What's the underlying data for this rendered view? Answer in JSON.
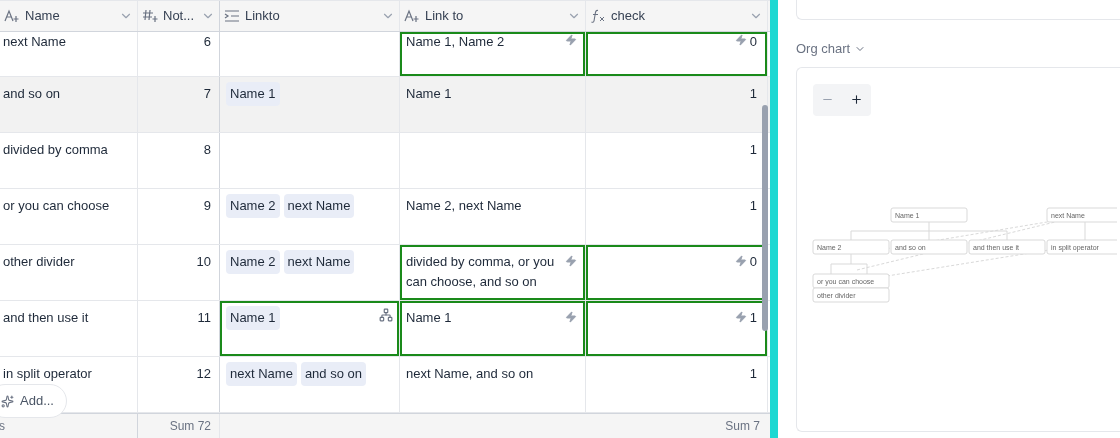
{
  "table": {
    "columns": [
      {
        "label": "Name",
        "kind": "text"
      },
      {
        "label": "Not...",
        "kind": "number"
      },
      {
        "label": "Linkto",
        "kind": "link"
      },
      {
        "label": "Link to",
        "kind": "lookup"
      },
      {
        "label": "check",
        "kind": "formula"
      }
    ],
    "rows": [
      {
        "name": "next Name",
        "number": "6",
        "tags": [],
        "link_to": {
          "text": "Name 1, Name 2",
          "highlighted": true
        },
        "check": {
          "text": "0",
          "highlighted": true
        },
        "linkto_highlighted": false,
        "hovered": false
      },
      {
        "name": "and so on",
        "number": "7",
        "tags": [
          "Name 1"
        ],
        "link_to": {
          "text": "Name 1",
          "highlighted": false
        },
        "check": {
          "text": "1",
          "highlighted": false
        },
        "linkto_highlighted": false,
        "hovered": true
      },
      {
        "name": "divided by comma",
        "number": "8",
        "tags": [],
        "link_to": {
          "highlighted": false
        },
        "check": {
          "text": "1",
          "highlighted": false
        },
        "linkto_highlighted": false,
        "hovered": false
      },
      {
        "name": "or you can choose",
        "number": "9",
        "tags": [
          "Name 2",
          "next Name"
        ],
        "link_to": {
          "text": "Name 2, next Name",
          "highlighted": false
        },
        "check": {
          "text": "1",
          "highlighted": false
        },
        "linkto_highlighted": false,
        "hovered": false
      },
      {
        "name": "other divider",
        "number": "10",
        "tags": [
          "Name 2",
          "next Name"
        ],
        "link_to": {
          "text": "divided by comma, or you can choose, and so on",
          "highlighted": true
        },
        "check": {
          "text": "0",
          "highlighted": true
        },
        "linkto_highlighted": false,
        "hovered": false
      },
      {
        "name": "and then use it",
        "number": "11",
        "tags": [
          "Name 1"
        ],
        "link_to": {
          "text": "Name 1",
          "highlighted": true
        },
        "check": {
          "text": "1",
          "highlighted": true
        },
        "linkto_highlighted": true,
        "hovered": false
      },
      {
        "name": "in split operator",
        "number": "12",
        "tags": [
          "next Name",
          "and so on"
        ],
        "link_to": {
          "text": "next Name, and so on",
          "highlighted": false
        },
        "check": {
          "text": "1",
          "highlighted": false
        },
        "linkto_highlighted": false,
        "hovered": false
      }
    ],
    "footer": {
      "count": "s",
      "number_sum": "Sum 72",
      "check_sum": "Sum 7"
    },
    "add_button": "Add..."
  },
  "side_panel": {
    "section_title": "Org chart",
    "org_chart": {
      "nodes": [
        "Name 1",
        "next Name",
        "Name 2",
        "and so on",
        "and then use it",
        "in split operator",
        "or you can choose",
        "other divider"
      ]
    }
  }
}
